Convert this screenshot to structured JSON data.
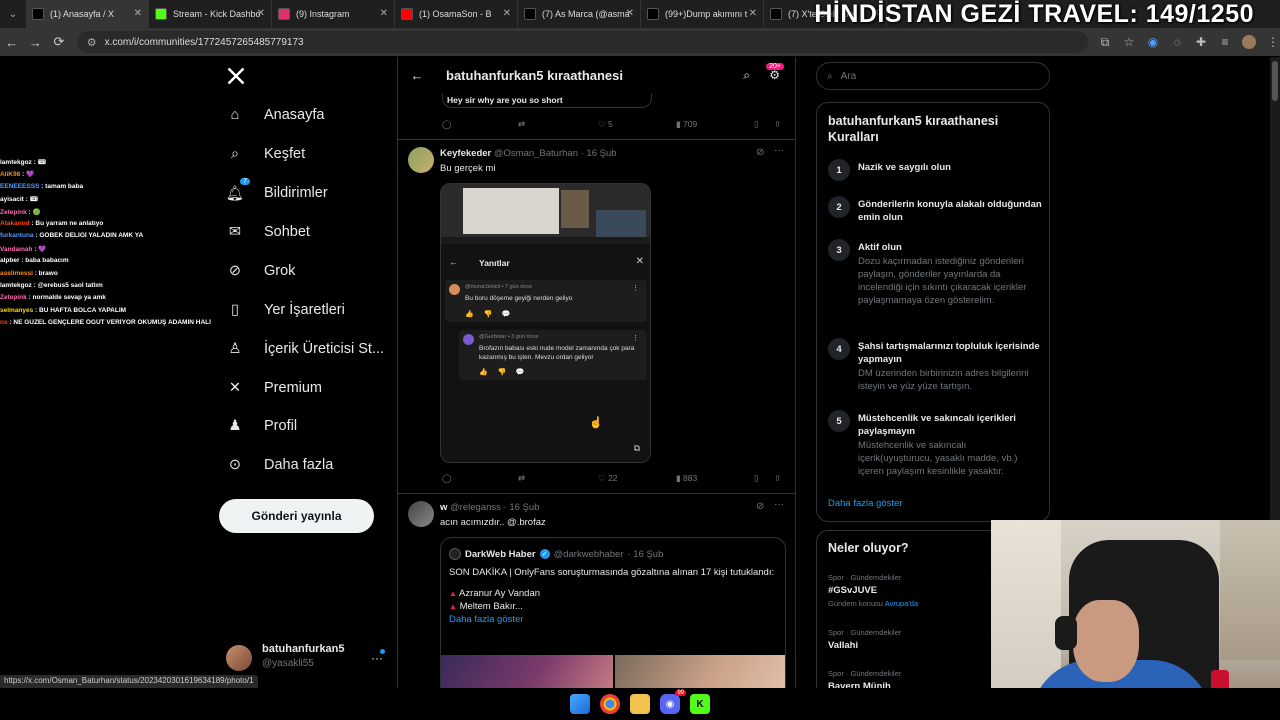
{
  "overlay_title": "HİNDİSTAN GEZİ TRAVEL: 149/1250",
  "tabs": [
    {
      "label": "(1) Anasayfa / X",
      "icon": "x-icon",
      "color": "#000000"
    },
    {
      "label": "Stream - Kick Dashbo",
      "icon": "kick-icon",
      "color": "#53fc18"
    },
    {
      "label": "(9) Instagram",
      "icon": "instagram-icon",
      "color": "#e1306c"
    },
    {
      "label": "(1) OsamaSon - B",
      "icon": "youtube-icon",
      "color": "#ff0000"
    },
    {
      "label": "(7) As Marca (@asma",
      "icon": "x-icon",
      "color": "#000000"
    },
    {
      "label": "(99+)Dump akımını t",
      "icon": "tiktok-icon",
      "color": "#000000"
    },
    {
      "label": "(7) X'te Daily Ge",
      "icon": "x-icon",
      "color": "#000000"
    }
  ],
  "url": "x.com/i/communities/1772457265485779173",
  "chat": [
    {
      "user": "lamtekgoz",
      "msg": "🎟",
      "color": "#ffffff"
    },
    {
      "user": "AliK98",
      "msg": "💜",
      "color": "#ff8c00"
    },
    {
      "user": "EENEEESSS",
      "msg": "tamam baba",
      "color": "#4a9eff"
    },
    {
      "user": "ayisacit",
      "msg": "🎟",
      "color": "#ffffff"
    },
    {
      "user": "Zetepink",
      "msg": "🟢",
      "color": "#ff69b4"
    },
    {
      "user": "Atakanod",
      "msg": "Bu yarram ne anlatıyo",
      "color": "#ff4500"
    },
    {
      "user": "furkantuna",
      "msg": "GÖBEK DELİĞİ YALADIN AMK YA",
      "color": "#4a9eff"
    },
    {
      "user": "Vandamah",
      "msg": "💜",
      "color": "#ff69b4"
    },
    {
      "user": "alpber",
      "msg": "baba babacım",
      "color": "#ffffff"
    },
    {
      "user": "aselimessi",
      "msg": "brawo",
      "color": "#ff8c00"
    },
    {
      "user": "lamtekgoz",
      "msg": "@erebus5 saol tatlım",
      "color": "#ffffff"
    },
    {
      "user": "Zetepink",
      "msg": "normalde sevap ya amk",
      "color": "#ff69b4"
    },
    {
      "user": "selmanyes",
      "msg": "BU HAFTA BOLCA YAPALIM",
      "color": "#ffd700"
    },
    {
      "user": "ns",
      "msg": "NE GÜZEL GENÇLERE ÖĞÜT VERİYOR OKUMUŞ ADAMIN HALİ",
      "color": "#ff4500"
    }
  ],
  "nav": {
    "items": [
      {
        "label": "Anasayfa",
        "icon": "home-icon"
      },
      {
        "label": "Keşfet",
        "icon": "search-icon"
      },
      {
        "label": "Bildirimler",
        "icon": "bell-icon",
        "badge": "7"
      },
      {
        "label": "Sohbet",
        "icon": "mail-icon"
      },
      {
        "label": "Grok",
        "icon": "grok-icon"
      },
      {
        "label": "Yer İşaretleri",
        "icon": "bookmark-icon"
      },
      {
        "label": "İçerik Üreticisi St...",
        "icon": "creator-icon"
      },
      {
        "label": "Premium",
        "icon": "x-icon"
      },
      {
        "label": "Profil",
        "icon": "person-icon"
      },
      {
        "label": "Daha fazla",
        "icon": "more-circle-icon"
      }
    ],
    "post_button": "Gönderi yayınla",
    "profile_name": "batuhanfurkan5",
    "profile_handle": "@yasakli55"
  },
  "header": {
    "title": "batuhanfurkan5 kıraathanesi",
    "badge": "20+"
  },
  "prev_tweet": {
    "snippet": "Hey sir why are you so short",
    "likes": "5",
    "views": "709"
  },
  "tweet1": {
    "name": "Keyfekeder",
    "handle": "@Osman_Baturhan",
    "date": "· 16 Şub",
    "text": "Bu gerçek mi",
    "likes": "22",
    "views": "883",
    "image": {
      "panel_title": "Yanıtlar",
      "reply1_meta": "@murat.binicii • 7 gün önce",
      "reply1_text": "Bu boru döşeme geyiği nerden geliyo",
      "reply2_meta": "@Gurbotar • 3 gün önce",
      "reply2_text": "Brofazın babası eski nude model zamanında çok para kazanmış bu işten. Mevzu ordan geliyor"
    }
  },
  "tweet2": {
    "name": "w",
    "handle": "@releganss",
    "date": "· 16 Şub",
    "text": "acın acımızdır.. @.brofaz",
    "quote": {
      "name": "DarkWeb Haber",
      "handle": "@darkwebhaber",
      "date": "· 16 Şub",
      "line1": "SON DAKİKA | OnlyFans soruşturmasında gözaltına alınan 17 kişi tutuklandı:",
      "line2": "Azranur Ay Vandan",
      "line3": "Meltem Bakır...",
      "more": "Daha fazla göster"
    }
  },
  "right": {
    "search_placeholder": "Ara",
    "rules_title": "batuhanfurkan5 kıraathanesi Kuralları",
    "rules": [
      {
        "num": "1",
        "title": "Nazik ve saygılı olun",
        "desc": ""
      },
      {
        "num": "2",
        "title": "Gönderilerin konuyla alakalı olduğundan emin olun",
        "desc": ""
      },
      {
        "num": "3",
        "title": "Aktif olun",
        "desc": "Dozu kaçırmadan istediğiniz gönderileri paylaşın, gönderiler yayınlarda da incelendiği için sıkıntı çıkaracak içerikler paylaşmamaya özen gösterelim."
      },
      {
        "num": "4",
        "title": "Şahsi tartışmalarınızı topluluk içerisinde yapmayın",
        "desc": "DM üzerinden birbirinizin adres bilgilerini isteyin ve yüz yüze tartışın."
      },
      {
        "num": "5",
        "title": "Müstehcenlik ve sakıncalı içerikleri paylaşmayın",
        "desc": "Müstehcenlik ve sakıncalı içerik(uyuşturucu, yasaklı madde, vb.) içeren paylaşım kesinlikle yasaktır."
      }
    ],
    "rules_more": "Daha fazla göster",
    "trends_title": "Neler oluyor?",
    "trends": [
      {
        "cat": "Spor · Gündemdekiler",
        "name": "#GSvJUVE",
        "sub_prefix": "Gündem konusu ",
        "sub_link": "Avrupa'da"
      },
      {
        "cat": "Spor · Gündemdekiler",
        "name": "Vallahi",
        "sub_prefix": "",
        "sub_link": ""
      },
      {
        "cat": "Spor · Gündemdekiler",
        "name": "Bayern Münih",
        "sub_prefix": "",
        "sub_link": ""
      }
    ]
  },
  "status_url": "https://x.com/Osman_Baturhan/status/2023420301619634189/photo/1",
  "taskbar_badge": "99"
}
